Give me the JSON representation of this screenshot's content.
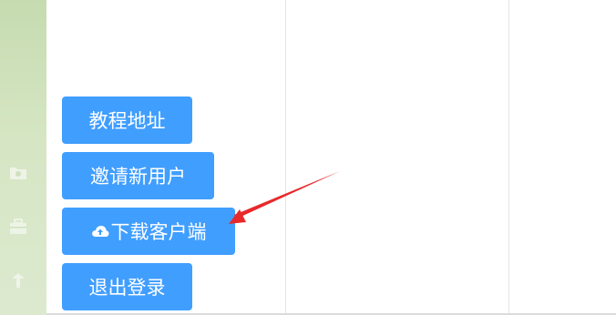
{
  "sidebar": {
    "icons": [
      "folder-icon",
      "briefcase-icon",
      "pin-icon"
    ]
  },
  "menu": {
    "tutorial_label": "教程地址",
    "invite_label": "邀请新用户",
    "download_label": "下载客户端",
    "logout_label": "退出登录",
    "download_icon": "cloud-upload-icon"
  },
  "colors": {
    "button": "#409eff",
    "button_text": "#ffffff",
    "sidebar": "#d6e6c4",
    "arrow": "#e8292b"
  }
}
